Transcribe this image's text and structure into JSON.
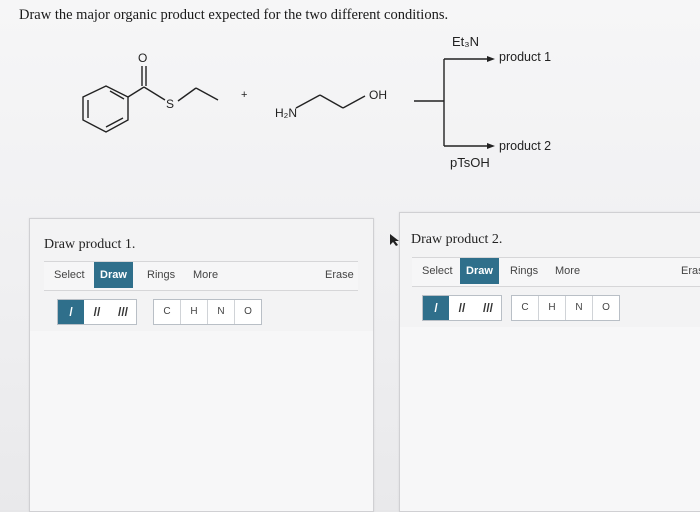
{
  "question": "Draw the major organic product expected for the two different conditions.",
  "scheme": {
    "carbonyl_o": "O",
    "sulfur": "S",
    "plus": "+",
    "amine": "H₂N",
    "hydroxyl": "OH",
    "reagent_top": "Et₃N",
    "reagent_bottom": "pTsOH",
    "product_top": "product 1",
    "product_bottom": "product 2"
  },
  "panels": [
    {
      "title": "Draw product 1.",
      "select": "Select",
      "draw": "Draw",
      "rings": "Rings",
      "more": "More",
      "erase": "Erase",
      "bonds": [
        "/",
        "//",
        "///"
      ],
      "atoms": [
        "C",
        "H",
        "N",
        "O"
      ]
    },
    {
      "title": "Draw product 2.",
      "select": "Select",
      "draw": "Draw",
      "rings": "Rings",
      "more": "More",
      "erase": "Eras",
      "bonds": [
        "/",
        "//",
        "///"
      ],
      "atoms": [
        "C",
        "H",
        "N",
        "O"
      ]
    }
  ],
  "colors": {
    "accent": "#2f6f8b"
  }
}
